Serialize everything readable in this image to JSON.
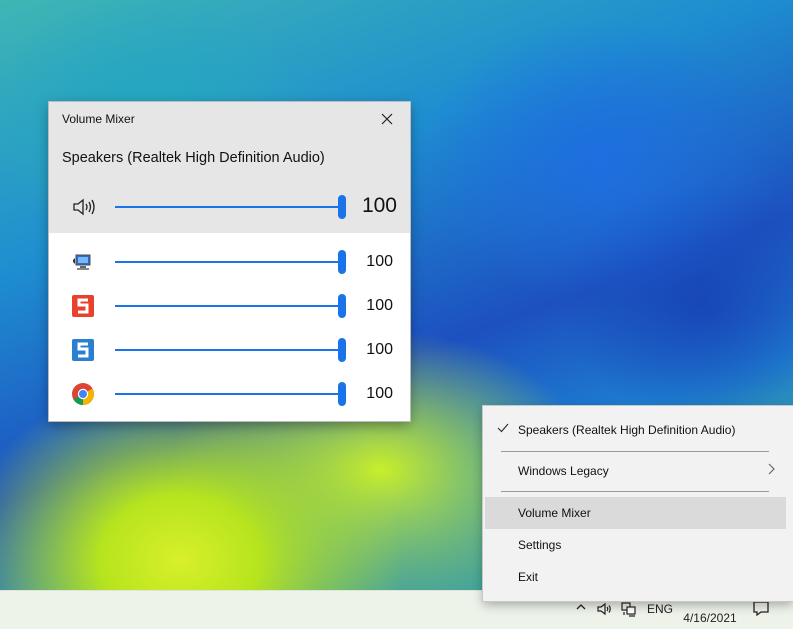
{
  "mixer": {
    "title": "Volume Mixer",
    "device": "Speakers (Realtek High Definition Audio)",
    "master": {
      "icon": "speaker-icon",
      "value": "100",
      "level": 1.0
    },
    "apps": [
      {
        "icon": "system-sounds-icon",
        "value": "100",
        "level": 1.0
      },
      {
        "icon": "snagit-red-icon",
        "value": "100",
        "level": 1.0
      },
      {
        "icon": "snagit-blue-icon",
        "value": "100",
        "level": 1.0
      },
      {
        "icon": "chrome-icon",
        "value": "100",
        "level": 1.0
      }
    ]
  },
  "menu": {
    "items": [
      {
        "label": "Speakers (Realtek High Definition Audio)",
        "checked": true
      },
      {
        "label": "Windows Legacy",
        "submenu": true
      },
      {
        "label": "Volume Mixer",
        "highlighted": true
      },
      {
        "label": "Settings"
      },
      {
        "label": "Exit"
      }
    ]
  },
  "taskbar": {
    "language": "ENG",
    "date": "4/16/2021"
  },
  "colors": {
    "accent": "#1a73e8"
  }
}
